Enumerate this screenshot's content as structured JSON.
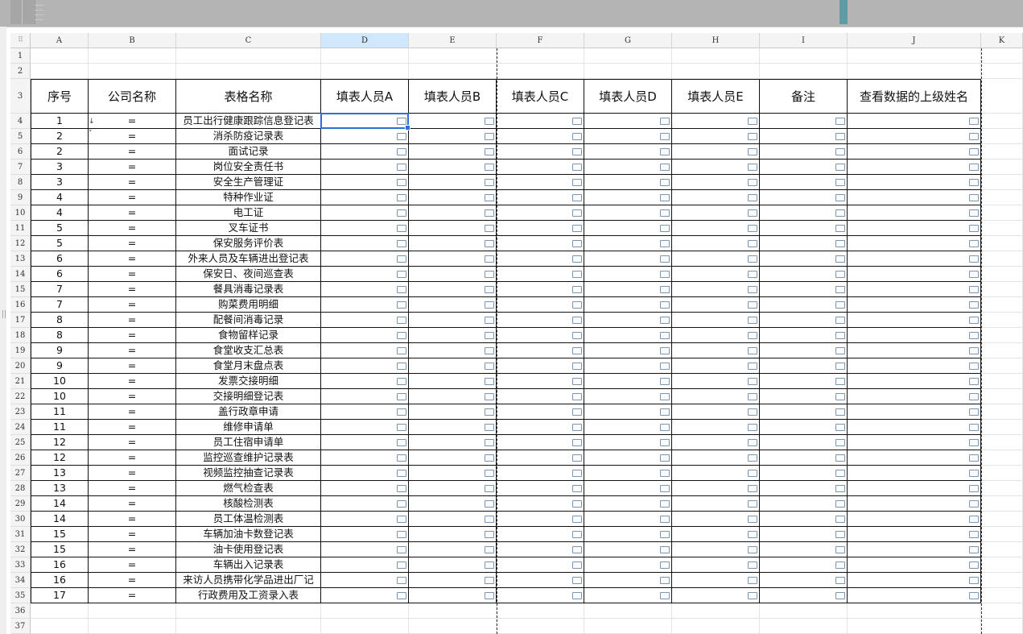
{
  "columns": [
    "A",
    "B",
    "C",
    "D",
    "E",
    "F",
    "G",
    "H",
    "I",
    "J",
    "K"
  ],
  "selected_column": "D",
  "selected_cell": "D4",
  "row_numbers": [
    "1",
    "2",
    "3",
    "4",
    "5",
    "6",
    "7",
    "8",
    "9",
    "10",
    "11",
    "12",
    "13",
    "14",
    "15",
    "16",
    "17",
    "18",
    "19",
    "20",
    "21",
    "22",
    "23",
    "24",
    "25",
    "26",
    "27",
    "28",
    "29",
    "30",
    "31",
    "32",
    "33",
    "34",
    "35",
    "36",
    "37"
  ],
  "headers": {
    "seq": "序号",
    "company": "公司名称",
    "form": "表格名称",
    "filler_a": "填表人员A",
    "filler_b": "填表人员B",
    "filler_c": "填表人员C",
    "filler_d": "填表人员D",
    "filler_e": "填表人员E",
    "remark": "备注",
    "superior": "查看数据的上级姓名"
  },
  "rows": [
    {
      "seq": "1",
      "company": "=",
      "form": "员工出行健康跟踪信息登记表"
    },
    {
      "seq": "2",
      "company": "=",
      "form": "消杀防疫记录表"
    },
    {
      "seq": "2",
      "company": "=",
      "form": "面试记录"
    },
    {
      "seq": "3",
      "company": "=",
      "form": "岗位安全责任书"
    },
    {
      "seq": "3",
      "company": "=",
      "form": "安全生产管理证"
    },
    {
      "seq": "4",
      "company": "=",
      "form": "特种作业证"
    },
    {
      "seq": "4",
      "company": "=",
      "form": "电工证"
    },
    {
      "seq": "5",
      "company": "=",
      "form": "叉车证书"
    },
    {
      "seq": "5",
      "company": "=",
      "form": "保安服务评价表"
    },
    {
      "seq": "6",
      "company": "=",
      "form": "外来人员及车辆进出登记表"
    },
    {
      "seq": "6",
      "company": "=",
      "form": "保安日、夜间巡查表"
    },
    {
      "seq": "7",
      "company": "=",
      "form": "餐具消毒记录表"
    },
    {
      "seq": "7",
      "company": "=",
      "form": "购菜费用明细"
    },
    {
      "seq": "8",
      "company": "=",
      "form": "配餐间消毒记录"
    },
    {
      "seq": "8",
      "company": "=",
      "form": "食物留样记录"
    },
    {
      "seq": "9",
      "company": "=",
      "form": "食堂收支汇总表"
    },
    {
      "seq": "9",
      "company": "=",
      "form": "食堂月末盘点表"
    },
    {
      "seq": "10",
      "company": "=",
      "form": "发票交接明细"
    },
    {
      "seq": "10",
      "company": "=",
      "form": "交接明细登记表"
    },
    {
      "seq": "11",
      "company": "=",
      "form": "盖行政章申请"
    },
    {
      "seq": "11",
      "company": "=",
      "form": "维修申请单"
    },
    {
      "seq": "12",
      "company": "=",
      "form": "员工住宿申请单"
    },
    {
      "seq": "12",
      "company": "=",
      "form": "监控巡查维护记录表"
    },
    {
      "seq": "13",
      "company": "=",
      "form": "视频监控抽查记录表"
    },
    {
      "seq": "13",
      "company": "=",
      "form": "燃气检查表"
    },
    {
      "seq": "14",
      "company": "=",
      "form": "核酸检测表"
    },
    {
      "seq": "14",
      "company": "=",
      "form": "员工体温检测表"
    },
    {
      "seq": "15",
      "company": "=",
      "form": "车辆加油卡数登记表"
    },
    {
      "seq": "15",
      "company": "=",
      "form": "油卡使用登记表"
    },
    {
      "seq": "16",
      "company": "=",
      "form": "车辆出入记录表"
    },
    {
      "seq": "16",
      "company": "=",
      "form": "来访人员携带化学品进出厂记"
    },
    {
      "seq": "17",
      "company": "=",
      "form": "行政费用及工资录入表"
    }
  ]
}
